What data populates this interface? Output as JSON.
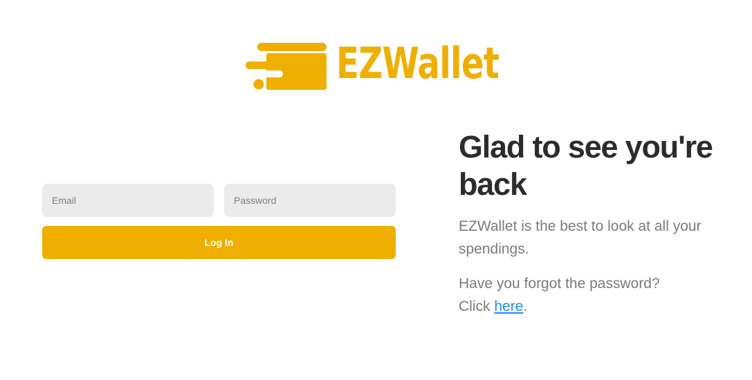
{
  "brand": {
    "name": "EZWallet",
    "color": "#efaf00"
  },
  "login_form": {
    "email_placeholder": "Email",
    "password_placeholder": "Password",
    "login_button_label": "Log In"
  },
  "welcome": {
    "heading": "Glad to see you're back",
    "description": "EZWallet is the best to look at all your spendings.",
    "forgot_question": "Have you forgot the password?",
    "click_prefix": "Click",
    "here_link": "here",
    "period": "."
  },
  "colors": {
    "accent": "#efaf00",
    "link": "#1e8bf0",
    "input_bg": "#ebebeb",
    "heading": "#2c2c2c",
    "body_text": "#7a7a7a"
  }
}
